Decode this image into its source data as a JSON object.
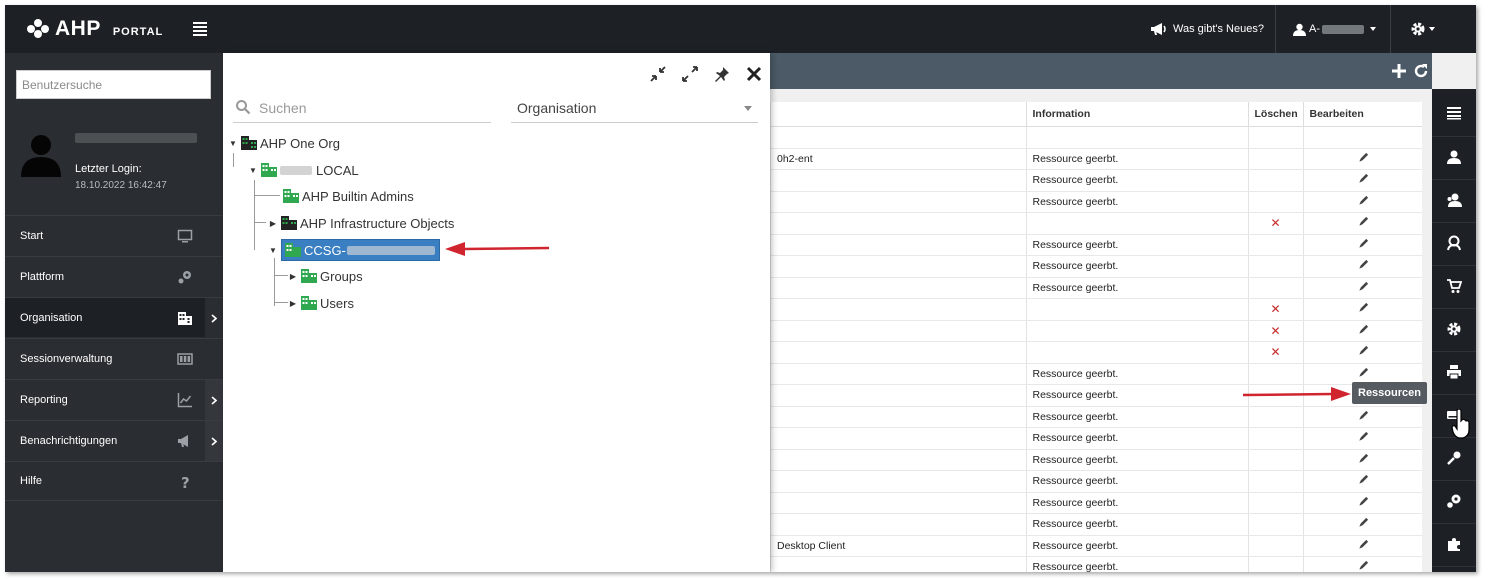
{
  "brand": {
    "name": "AHP",
    "sub": "PORTAL"
  },
  "topbar": {
    "news": "Was gibt's Neues?",
    "user": "A-"
  },
  "sidebar": {
    "search_placeholder": "Benutzersuche",
    "last_login_label": "Letzter Login:",
    "last_login_value": "18.10.2022 16:42:47",
    "items": [
      {
        "label": "Start",
        "icon": "monitor-icon"
      },
      {
        "label": "Plattform",
        "icon": "platform-icon"
      },
      {
        "label": "Organisation",
        "icon": "building-icon"
      },
      {
        "label": "Sessionverwaltung",
        "icon": "session-icon"
      },
      {
        "label": "Reporting",
        "icon": "chart-icon"
      },
      {
        "label": "Benachrichtigungen",
        "icon": "megaphone-icon"
      },
      {
        "label": "Hilfe",
        "icon": "help-icon"
      }
    ]
  },
  "tree_panel": {
    "search_placeholder": "Suchen",
    "org_select": "Organisation",
    "nodes": [
      {
        "label": "AHP One Org"
      },
      {
        "label": "LOCAL"
      },
      {
        "label": "AHP Builtin Admins"
      },
      {
        "label": "AHP Infrastructure Objects"
      },
      {
        "label": "CCSG-"
      },
      {
        "label": "Groups"
      },
      {
        "label": "Users"
      }
    ]
  },
  "table": {
    "headers": {
      "information": "Information",
      "delete": "Löschen",
      "edit": "Bearbeiten"
    },
    "rows": [
      {
        "name": "0h2-ent",
        "info": "Ressource geerbt.",
        "delete": false
      },
      {
        "name": "",
        "info": "Ressource geerbt.",
        "delete": false
      },
      {
        "name": "",
        "info": "Ressource geerbt.",
        "delete": false
      },
      {
        "name": "",
        "info": "",
        "delete": true
      },
      {
        "name": "",
        "info": "Ressource geerbt.",
        "delete": false
      },
      {
        "name": "",
        "info": "Ressource geerbt.",
        "delete": false
      },
      {
        "name": "",
        "info": "Ressource geerbt.",
        "delete": false
      },
      {
        "name": "",
        "info": "",
        "delete": true
      },
      {
        "name": "",
        "info": "",
        "delete": true
      },
      {
        "name": "",
        "info": "",
        "delete": true
      },
      {
        "name": "",
        "info": "Ressource geerbt.",
        "delete": false
      },
      {
        "name": "",
        "info": "Ressource geerbt.",
        "delete": false
      },
      {
        "name": "",
        "info": "Ressource geerbt.",
        "delete": false
      },
      {
        "name": "",
        "info": "Ressource geerbt.",
        "delete": false
      },
      {
        "name": "",
        "info": "Ressource geerbt.",
        "delete": false
      },
      {
        "name": "",
        "info": "Ressource geerbt.",
        "delete": false
      },
      {
        "name": "",
        "info": "Ressource geerbt.",
        "delete": false
      },
      {
        "name": "",
        "info": "Ressource geerbt.",
        "delete": false
      },
      {
        "name": "Desktop Client",
        "info": "Ressource geerbt.",
        "delete": false
      },
      {
        "name": "",
        "info": "Ressource geerbt.",
        "delete": false
      }
    ]
  },
  "rightbar": {
    "tooltip": "Ressourcen",
    "items": [
      "list-icon",
      "user-icon",
      "user-group-icon",
      "users-icon",
      "cart-icon",
      "gear-icon",
      "printer-icon",
      "resources-icon",
      "tools-icon",
      "platform-icon",
      "puzzle-icon",
      "share-icon"
    ]
  },
  "colors": {
    "dark": "#1d2126",
    "sidebar": "#2a2d31",
    "selected": "#3a7fc1",
    "tree_green": "#2fa84f",
    "arrow_red": "#d0242f"
  }
}
